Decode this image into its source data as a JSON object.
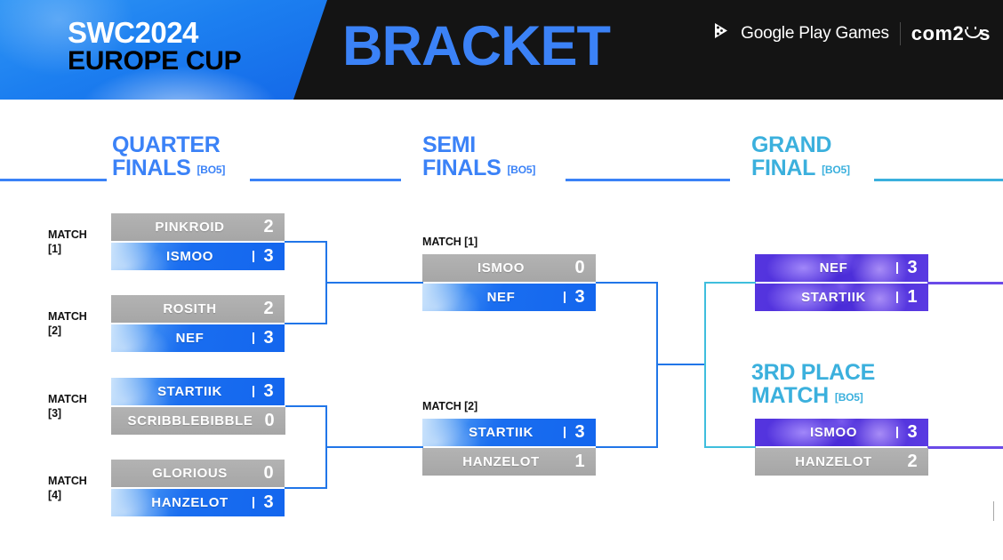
{
  "header": {
    "event_line1": "SWC2024",
    "event_line2": "EUROPE CUP",
    "title": "BRACKET",
    "sponsor_google": "Google Play Games",
    "sponsor_com2us_pre": "com2",
    "sponsor_com2us_post": "s",
    "icons": {
      "google_play_games": "google-play-games-icon"
    },
    "colors": {
      "bg": "#141414",
      "title": "#3b82f7",
      "panel_blue": "#1c7ff0"
    }
  },
  "rounds": [
    {
      "line1": "QUARTER",
      "line2": "FINALS",
      "bo": "[BO5]",
      "color": "#3b82f7"
    },
    {
      "line1": "SEMI",
      "line2": "FINALS",
      "bo": "[BO5]",
      "color": "#3b82f7"
    },
    {
      "line1": "GRAND",
      "line2": "FINAL",
      "bo": "[BO5]",
      "color": "#3bb0dd"
    },
    {
      "line1": "3RD PLACE",
      "line2": "MATCH",
      "bo": "[BO5]",
      "color": "#3bb0dd"
    }
  ],
  "quarterfinals": [
    {
      "label_line1": "MATCH",
      "label_line2": "[1]",
      "rows": [
        {
          "name": "PINKROID",
          "score": "2",
          "state": "lose"
        },
        {
          "name": "ISMOO",
          "score": "3",
          "state": "win"
        }
      ]
    },
    {
      "label_line1": "MATCH",
      "label_line2": "[2]",
      "rows": [
        {
          "name": "ROSITH",
          "score": "2",
          "state": "lose"
        },
        {
          "name": "NEF",
          "score": "3",
          "state": "win"
        }
      ]
    },
    {
      "label_line1": "MATCH",
      "label_line2": "[3]",
      "rows": [
        {
          "name": "STARTIIK",
          "score": "3",
          "state": "win"
        },
        {
          "name": "SCRIBBLEBIBBLE",
          "score": "0",
          "state": "lose"
        }
      ]
    },
    {
      "label_line1": "MATCH",
      "label_line2": "[4]",
      "rows": [
        {
          "name": "GLORIOUS",
          "score": "0",
          "state": "lose"
        },
        {
          "name": "HANZELOT",
          "score": "3",
          "state": "win"
        }
      ]
    }
  ],
  "semifinals": [
    {
      "label": "MATCH [1]",
      "rows": [
        {
          "name": "ISMOO",
          "score": "0",
          "state": "lose"
        },
        {
          "name": "NEF",
          "score": "3",
          "state": "win"
        }
      ]
    },
    {
      "label": "MATCH [2]",
      "rows": [
        {
          "name": "STARTIIK",
          "score": "3",
          "state": "win"
        },
        {
          "name": "HANZELOT",
          "score": "1",
          "state": "lose"
        }
      ]
    }
  ],
  "grand_final": {
    "rows": [
      {
        "name": "NEF",
        "score": "3",
        "state": "purple"
      },
      {
        "name": "STARTIIK",
        "score": "1",
        "state": "purple"
      }
    ]
  },
  "third_place": {
    "rows": [
      {
        "name": "ISMOO",
        "score": "3",
        "state": "purple"
      },
      {
        "name": "HANZELOT",
        "score": "2",
        "state": "lose"
      }
    ]
  },
  "colors": {
    "winner_blue": "#1a6ef0",
    "loser_gray": "#a9a9a9",
    "purple": "#4a2cd8",
    "line_blue": "#2176e8",
    "line_teal": "#3fbedd",
    "line_purple": "#6a4ae8"
  }
}
